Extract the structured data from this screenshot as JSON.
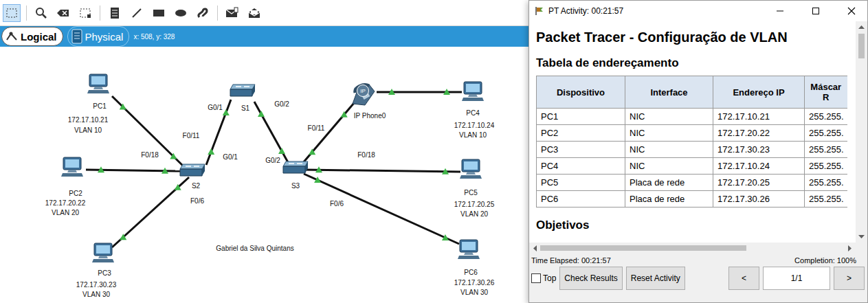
{
  "toolbar": {
    "tools": [
      {
        "kind": "select",
        "selected": true
      },
      {
        "kind": "inspect",
        "selected": false
      },
      {
        "kind": "delete",
        "selected": false
      },
      {
        "kind": "resize",
        "selected": false
      },
      {
        "kind": "note",
        "selected": false
      },
      {
        "kind": "line",
        "selected": false
      },
      {
        "kind": "rectangle",
        "selected": false
      },
      {
        "kind": "ellipse",
        "selected": false
      },
      {
        "kind": "freehand",
        "selected": false
      },
      {
        "kind": "simple-pdu",
        "selected": false
      },
      {
        "kind": "complex-pdu",
        "selected": false
      }
    ]
  },
  "view_tabs": [
    {
      "label": "Logical",
      "selected": true
    },
    {
      "label": "Physical",
      "selected": false
    }
  ],
  "coordinates": "x: 508, y: 328",
  "diagram": {
    "nodes": [
      {
        "label": "PC1",
        "kind": "pc",
        "ip": "172.17.10.21",
        "vlan": "VLAN 10"
      },
      {
        "label": "PC2",
        "kind": "pc",
        "ip": "172.17.20.22",
        "vlan": "VLAN 20"
      },
      {
        "label": "PC3",
        "kind": "pc",
        "ip": "172.17.30.23",
        "vlan": "VLAN 30"
      },
      {
        "label": "S1",
        "kind": "switch"
      },
      {
        "label": "S2",
        "kind": "switch"
      },
      {
        "label": "S3",
        "kind": "switch"
      },
      {
        "label": "IP Phone0",
        "kind": "phone",
        "badge": "IP"
      },
      {
        "label": "PC4",
        "kind": "pc",
        "ip": "172.17.10.24",
        "vlan": "VLAN 10"
      },
      {
        "label": "PC5",
        "kind": "pc",
        "ip": "172.17.20.25",
        "vlan": "VLAN 20"
      },
      {
        "label": "PC6",
        "kind": "pc",
        "ip": "172.17.30.26",
        "vlan": "VLAN 30"
      }
    ],
    "ports": [
      "F0/11",
      "G0/1",
      "G0/1",
      "G0/2",
      "G0/2",
      "F0/18",
      "F0/6",
      "F0/11",
      "F0/18",
      "F0/6"
    ],
    "links": [
      {
        "a": "PC1",
        "b": "S2",
        "up": true
      },
      {
        "a": "PC2",
        "b": "S2",
        "up": true
      },
      {
        "a": "PC3",
        "b": "S2",
        "up": true
      },
      {
        "a": "S2",
        "b": "S1",
        "up": true
      },
      {
        "a": "S1",
        "b": "S3",
        "up": true
      },
      {
        "a": "S3",
        "b": "IP Phone0",
        "up": true
      },
      {
        "a": "IP Phone0",
        "b": "PC4",
        "up": true
      },
      {
        "a": "S3",
        "b": "PC5",
        "up": true
      },
      {
        "a": "S3",
        "b": "PC6",
        "up": true
      }
    ],
    "author": "Gabriel da Silva Quintans"
  },
  "activity": {
    "title": "PT Activity: 00:21:57",
    "heading": "Packet Tracer - Configuração de VLAN",
    "table_title": "Tabela de endereçamento",
    "table": {
      "columns": [
        "Dispositivo",
        "Interface",
        "Endereço IP",
        "Máscar\nR"
      ],
      "rows": [
        [
          "PC1",
          "NIC",
          "172.17.10.21",
          "255.255."
        ],
        [
          "PC2",
          "NIC",
          "172.17.20.22",
          "255.255."
        ],
        [
          "PC3",
          "NIC",
          "172.17.30.23",
          "255.255."
        ],
        [
          "PC4",
          "NIC",
          "172.17.10.24",
          "255.255."
        ],
        [
          "PC5",
          "Placa de rede",
          "172.17.20.25",
          "255.255."
        ],
        [
          "PC6",
          "Placa de rede",
          "172.17.30.26",
          "255.255."
        ]
      ]
    },
    "objectives_title": "Objetivos",
    "time_elapsed": "Time Elapsed: 00:21:57",
    "completion": "Completion: 100%",
    "top_checkbox": {
      "label": "Top",
      "checked": false
    },
    "buttons": [
      "Check Results",
      "Reset Activity"
    ],
    "prev": "<",
    "page": "1/1",
    "next": ">"
  }
}
